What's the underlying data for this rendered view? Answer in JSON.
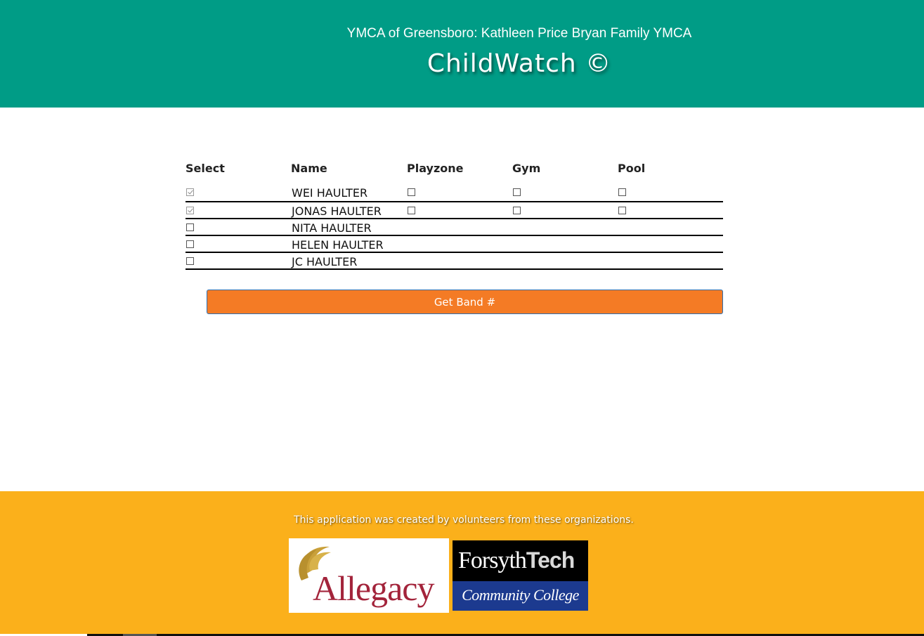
{
  "header": {
    "subtitle": "YMCA of Greensboro: Kathleen Price Bryan Family YMCA",
    "title": "ChildWatch ©",
    "background_color": "#009c86"
  },
  "table": {
    "columns": [
      "Select",
      "Name",
      "Playzone",
      "Gym",
      "Pool"
    ],
    "rows": [
      {
        "name": "WEI HAULTER",
        "selected": true,
        "playzone": false,
        "gym": false,
        "pool": false,
        "areas_visible": true
      },
      {
        "name": "JONAS HAULTER",
        "selected": true,
        "playzone": false,
        "gym": false,
        "pool": false,
        "areas_visible": true
      },
      {
        "name": "NITA HAULTER",
        "selected": false,
        "areas_visible": false
      },
      {
        "name": "HELEN HAULTER",
        "selected": false,
        "areas_visible": false
      },
      {
        "name": "JC HAULTER",
        "selected": false,
        "areas_visible": false
      }
    ]
  },
  "actions": {
    "get_band_label": "Get Band #",
    "button_color": "#f47b25"
  },
  "footer": {
    "text": "This application was created by volunteers from these organizations.",
    "background_color": "#fbb01b",
    "logos": {
      "allegacy": "Allegacy",
      "forsyth_main": "Forsyth",
      "forsyth_tech": "Tech",
      "forsyth_sub": "Community College"
    }
  }
}
